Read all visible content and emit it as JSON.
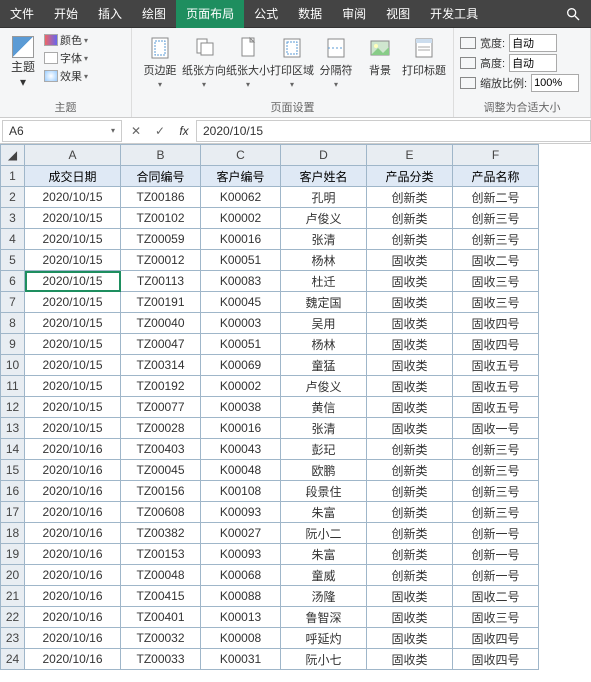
{
  "menu": {
    "file": "文件",
    "home": "开始",
    "insert": "插入",
    "draw": "绘图",
    "layout": "页面布局",
    "formula": "公式",
    "data": "数据",
    "review": "审阅",
    "view": "视图",
    "dev": "开发工具"
  },
  "ribbon": {
    "theme": {
      "label": "主题",
      "btn": "主题",
      "color": "颜色",
      "font": "字体",
      "effect": "效果"
    },
    "pagesetup": {
      "label": "页面设置",
      "margin": "页边距",
      "orient": "纸张方向",
      "size": "纸张大小",
      "area": "打印区域",
      "break": "分隔符",
      "bg": "背景",
      "titles": "打印标题"
    },
    "scale": {
      "label": "调整为合适大小",
      "width": "宽度:",
      "height": "高度:",
      "zoom": "缩放比例:",
      "auto": "自动",
      "pct": "100%"
    }
  },
  "namebox": "A6",
  "fx": "fx",
  "formula": "2020/10/15",
  "cols": [
    "A",
    "B",
    "C",
    "D",
    "E",
    "F"
  ],
  "headers": [
    "成交日期",
    "合同编号",
    "客户编号",
    "客户姓名",
    "产品分类",
    "产品名称"
  ],
  "rows": [
    [
      "2020/10/15",
      "TZ00186",
      "K00062",
      "孔明",
      "创新类",
      "创新二号"
    ],
    [
      "2020/10/15",
      "TZ00102",
      "K00002",
      "卢俊义",
      "创新类",
      "创新三号"
    ],
    [
      "2020/10/15",
      "TZ00059",
      "K00016",
      "张清",
      "创新类",
      "创新三号"
    ],
    [
      "2020/10/15",
      "TZ00012",
      "K00051",
      "杨林",
      "固收类",
      "固收二号"
    ],
    [
      "2020/10/15",
      "TZ00113",
      "K00083",
      "杜迁",
      "固收类",
      "固收三号"
    ],
    [
      "2020/10/15",
      "TZ00191",
      "K00045",
      "魏定国",
      "固收类",
      "固收三号"
    ],
    [
      "2020/10/15",
      "TZ00040",
      "K00003",
      "吴用",
      "固收类",
      "固收四号"
    ],
    [
      "2020/10/15",
      "TZ00047",
      "K00051",
      "杨林",
      "固收类",
      "固收四号"
    ],
    [
      "2020/10/15",
      "TZ00314",
      "K00069",
      "童猛",
      "固收类",
      "固收五号"
    ],
    [
      "2020/10/15",
      "TZ00192",
      "K00002",
      "卢俊义",
      "固收类",
      "固收五号"
    ],
    [
      "2020/10/15",
      "TZ00077",
      "K00038",
      "黄信",
      "固收类",
      "固收五号"
    ],
    [
      "2020/10/15",
      "TZ00028",
      "K00016",
      "张清",
      "固收类",
      "固收一号"
    ],
    [
      "2020/10/16",
      "TZ00403",
      "K00043",
      "彭玘",
      "创新类",
      "创新三号"
    ],
    [
      "2020/10/16",
      "TZ00045",
      "K00048",
      "欧鹏",
      "创新类",
      "创新三号"
    ],
    [
      "2020/10/16",
      "TZ00156",
      "K00108",
      "段景住",
      "创新类",
      "创新三号"
    ],
    [
      "2020/10/16",
      "TZ00608",
      "K00093",
      "朱富",
      "创新类",
      "创新三号"
    ],
    [
      "2020/10/16",
      "TZ00382",
      "K00027",
      "阮小二",
      "创新类",
      "创新一号"
    ],
    [
      "2020/10/16",
      "TZ00153",
      "K00093",
      "朱富",
      "创新类",
      "创新一号"
    ],
    [
      "2020/10/16",
      "TZ00048",
      "K00068",
      "童威",
      "创新类",
      "创新一号"
    ],
    [
      "2020/10/16",
      "TZ00415",
      "K00088",
      "汤隆",
      "固收类",
      "固收二号"
    ],
    [
      "2020/10/16",
      "TZ00401",
      "K00013",
      "鲁智深",
      "固收类",
      "固收三号"
    ],
    [
      "2020/10/16",
      "TZ00032",
      "K00008",
      "呼延灼",
      "固收类",
      "固收四号"
    ],
    [
      "2020/10/16",
      "TZ00033",
      "K00031",
      "阮小七",
      "固收类",
      "固收四号"
    ]
  ],
  "selectedRow": 6
}
